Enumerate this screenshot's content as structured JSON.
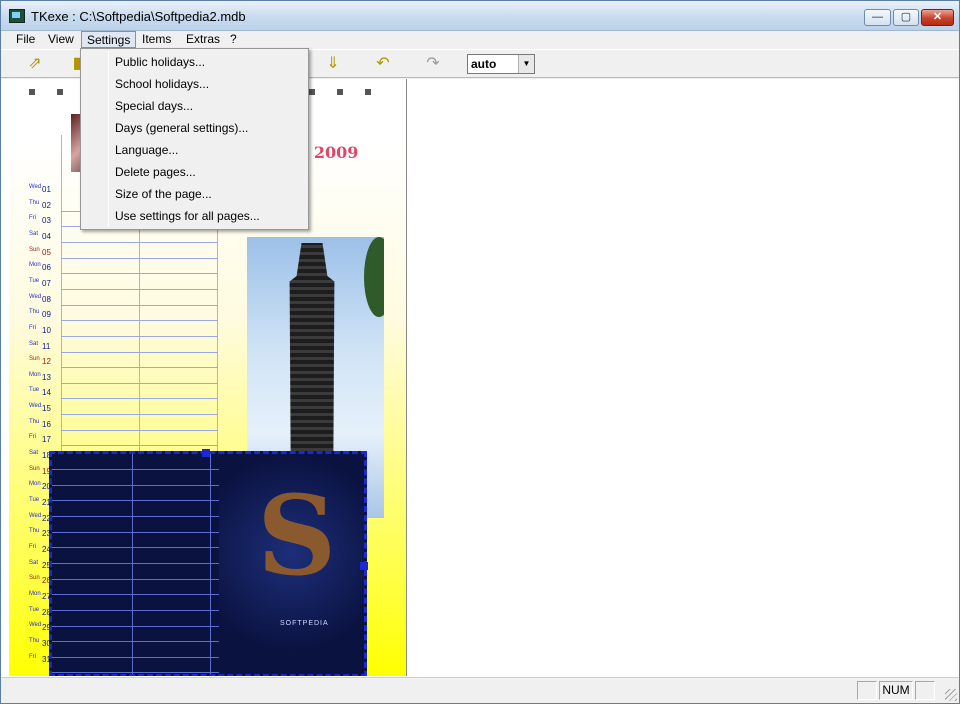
{
  "window": {
    "title": "TKexe : C:\\Softpedia\\Softpedia2.mdb",
    "min_glyph": "—",
    "max_glyph": "▢",
    "close_glyph": "✕"
  },
  "menubar": {
    "items": [
      "File",
      "View",
      "Settings",
      "Items",
      "Extras",
      "?"
    ]
  },
  "toolbar": {
    "icons": [
      "export-icon",
      "new-icon",
      "arrow-down-icon",
      "undo-icon",
      "redo-icon"
    ],
    "zoom_value": "auto"
  },
  "settings_menu": {
    "items": [
      "Public holidays...",
      "School holidays...",
      "Special days...",
      "Days (general settings)...",
      "Language...",
      "Delete pages...",
      "Size of the page...",
      "Use settings for all pages..."
    ]
  },
  "calendar": {
    "title": "y 2009",
    "days": [
      {
        "dn": "Wed",
        "dd": "01"
      },
      {
        "dn": "Thu",
        "dd": "02"
      },
      {
        "dn": "Fri",
        "dd": "03"
      },
      {
        "dn": "Sat",
        "dd": "04"
      },
      {
        "dn": "Sun",
        "dd": "05"
      },
      {
        "dn": "Mon",
        "dd": "06"
      },
      {
        "dn": "Tue",
        "dd": "07"
      },
      {
        "dn": "Wed",
        "dd": "08"
      },
      {
        "dn": "Thu",
        "dd": "09"
      },
      {
        "dn": "Fri",
        "dd": "10"
      },
      {
        "dn": "Sat",
        "dd": "11"
      },
      {
        "dn": "Sun",
        "dd": "12"
      },
      {
        "dn": "Mon",
        "dd": "13"
      },
      {
        "dn": "Tue",
        "dd": "14"
      },
      {
        "dn": "Wed",
        "dd": "15"
      },
      {
        "dn": "Thu",
        "dd": "16"
      },
      {
        "dn": "Fri",
        "dd": "17"
      },
      {
        "dn": "Sat",
        "dd": "18"
      },
      {
        "dn": "Sun",
        "dd": "19"
      },
      {
        "dn": "Mon",
        "dd": "20"
      },
      {
        "dn": "Tue",
        "dd": "21"
      },
      {
        "dn": "Wed",
        "dd": "22"
      },
      {
        "dn": "Thu",
        "dd": "23"
      },
      {
        "dn": "Fri",
        "dd": "24"
      },
      {
        "dn": "Sat",
        "dd": "25"
      },
      {
        "dn": "Sun",
        "dd": "26"
      },
      {
        "dn": "Mon",
        "dd": "27"
      },
      {
        "dn": "Tue",
        "dd": "28"
      },
      {
        "dn": "Wed",
        "dd": "29"
      },
      {
        "dn": "Thu",
        "dd": "30"
      },
      {
        "dn": "Fri",
        "dd": "31"
      }
    ],
    "poster_caption": "SOFTPEDIA",
    "poster_letter": "S"
  },
  "statusbar": {
    "num": "NUM"
  },
  "colors": {
    "accent": "#1a28d8",
    "calendar_title": "#e0456a",
    "page_yellow": "#ffff00"
  }
}
